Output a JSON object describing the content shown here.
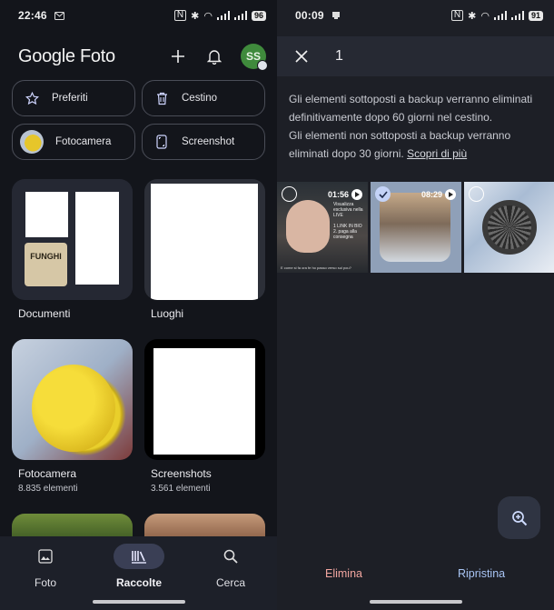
{
  "left": {
    "status": {
      "time": "22:46",
      "battery": "96"
    },
    "brand": "Google Foto",
    "avatar_initials": "SS",
    "chips": [
      {
        "label": "Preferiti",
        "icon": "star-icon"
      },
      {
        "label": "Cestino",
        "icon": "trash-icon"
      },
      {
        "label": "Fotocamera",
        "icon": "camera-album-thumb"
      },
      {
        "label": "Screenshot",
        "icon": "screenshot-icon"
      }
    ],
    "funghi_text": "FUNGHI",
    "albums": [
      {
        "title": "Documenti",
        "count": ""
      },
      {
        "title": "Luoghi",
        "count": ""
      },
      {
        "title": "Fotocamera",
        "count": "8.835 elementi"
      },
      {
        "title": "Screenshots",
        "count": "3.561 elementi"
      }
    ],
    "nav": [
      {
        "label": "Foto",
        "icon": "photo-icon",
        "active": false
      },
      {
        "label": "Raccolte",
        "icon": "library-icon",
        "active": true
      },
      {
        "label": "Cerca",
        "icon": "search-icon",
        "active": false
      }
    ]
  },
  "right": {
    "status": {
      "time": "00:09",
      "battery": "91"
    },
    "selected_count": "1",
    "notice_line1": "Gli elementi sottoposti a backup verranno eliminati definitivamente dopo 60 giorni nel cestino.",
    "notice_line2": "Gli elementi non sottoposti a backup verranno eliminati dopo 30 giorni.",
    "notice_link": "Scopri di più",
    "items": [
      {
        "duration": "01:56",
        "selected": false,
        "overlay_text": "Visualizza esclusiva nella LIVE",
        "overlay_text2": "1 LINK IN BIO",
        "overlay_text3": "2. paga alla consegna",
        "caption": "E come si fa ora fe ho passo verso sul pou?"
      },
      {
        "duration": "08:29",
        "selected": true
      },
      {
        "duration": "",
        "selected": false
      }
    ],
    "delete_label": "Elimina",
    "restore_label": "Ripristina"
  },
  "colors": {
    "accent": "#c4d3f7",
    "delete": "#f2a6a0",
    "restore": "#a9c5f5",
    "avatar_bg": "#3f8a3c"
  }
}
